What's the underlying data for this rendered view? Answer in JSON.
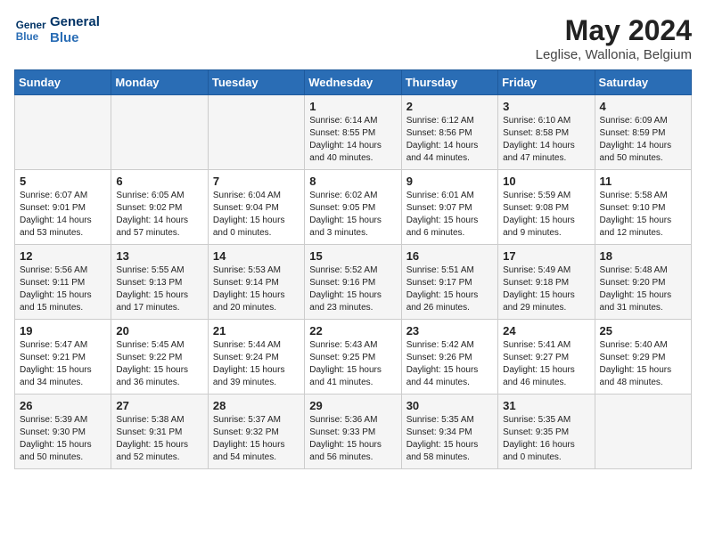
{
  "logo": {
    "line1": "General",
    "line2": "Blue"
  },
  "title": "May 2024",
  "subtitle": "Leglise, Wallonia, Belgium",
  "days_header": [
    "Sunday",
    "Monday",
    "Tuesday",
    "Wednesday",
    "Thursday",
    "Friday",
    "Saturday"
  ],
  "weeks": [
    [
      {
        "day": "",
        "info": ""
      },
      {
        "day": "",
        "info": ""
      },
      {
        "day": "",
        "info": ""
      },
      {
        "day": "1",
        "info": "Sunrise: 6:14 AM\nSunset: 8:55 PM\nDaylight: 14 hours\nand 40 minutes."
      },
      {
        "day": "2",
        "info": "Sunrise: 6:12 AM\nSunset: 8:56 PM\nDaylight: 14 hours\nand 44 minutes."
      },
      {
        "day": "3",
        "info": "Sunrise: 6:10 AM\nSunset: 8:58 PM\nDaylight: 14 hours\nand 47 minutes."
      },
      {
        "day": "4",
        "info": "Sunrise: 6:09 AM\nSunset: 8:59 PM\nDaylight: 14 hours\nand 50 minutes."
      }
    ],
    [
      {
        "day": "5",
        "info": "Sunrise: 6:07 AM\nSunset: 9:01 PM\nDaylight: 14 hours\nand 53 minutes."
      },
      {
        "day": "6",
        "info": "Sunrise: 6:05 AM\nSunset: 9:02 PM\nDaylight: 14 hours\nand 57 minutes."
      },
      {
        "day": "7",
        "info": "Sunrise: 6:04 AM\nSunset: 9:04 PM\nDaylight: 15 hours\nand 0 minutes."
      },
      {
        "day": "8",
        "info": "Sunrise: 6:02 AM\nSunset: 9:05 PM\nDaylight: 15 hours\nand 3 minutes."
      },
      {
        "day": "9",
        "info": "Sunrise: 6:01 AM\nSunset: 9:07 PM\nDaylight: 15 hours\nand 6 minutes."
      },
      {
        "day": "10",
        "info": "Sunrise: 5:59 AM\nSunset: 9:08 PM\nDaylight: 15 hours\nand 9 minutes."
      },
      {
        "day": "11",
        "info": "Sunrise: 5:58 AM\nSunset: 9:10 PM\nDaylight: 15 hours\nand 12 minutes."
      }
    ],
    [
      {
        "day": "12",
        "info": "Sunrise: 5:56 AM\nSunset: 9:11 PM\nDaylight: 15 hours\nand 15 minutes."
      },
      {
        "day": "13",
        "info": "Sunrise: 5:55 AM\nSunset: 9:13 PM\nDaylight: 15 hours\nand 17 minutes."
      },
      {
        "day": "14",
        "info": "Sunrise: 5:53 AM\nSunset: 9:14 PM\nDaylight: 15 hours\nand 20 minutes."
      },
      {
        "day": "15",
        "info": "Sunrise: 5:52 AM\nSunset: 9:16 PM\nDaylight: 15 hours\nand 23 minutes."
      },
      {
        "day": "16",
        "info": "Sunrise: 5:51 AM\nSunset: 9:17 PM\nDaylight: 15 hours\nand 26 minutes."
      },
      {
        "day": "17",
        "info": "Sunrise: 5:49 AM\nSunset: 9:18 PM\nDaylight: 15 hours\nand 29 minutes."
      },
      {
        "day": "18",
        "info": "Sunrise: 5:48 AM\nSunset: 9:20 PM\nDaylight: 15 hours\nand 31 minutes."
      }
    ],
    [
      {
        "day": "19",
        "info": "Sunrise: 5:47 AM\nSunset: 9:21 PM\nDaylight: 15 hours\nand 34 minutes."
      },
      {
        "day": "20",
        "info": "Sunrise: 5:45 AM\nSunset: 9:22 PM\nDaylight: 15 hours\nand 36 minutes."
      },
      {
        "day": "21",
        "info": "Sunrise: 5:44 AM\nSunset: 9:24 PM\nDaylight: 15 hours\nand 39 minutes."
      },
      {
        "day": "22",
        "info": "Sunrise: 5:43 AM\nSunset: 9:25 PM\nDaylight: 15 hours\nand 41 minutes."
      },
      {
        "day": "23",
        "info": "Sunrise: 5:42 AM\nSunset: 9:26 PM\nDaylight: 15 hours\nand 44 minutes."
      },
      {
        "day": "24",
        "info": "Sunrise: 5:41 AM\nSunset: 9:27 PM\nDaylight: 15 hours\nand 46 minutes."
      },
      {
        "day": "25",
        "info": "Sunrise: 5:40 AM\nSunset: 9:29 PM\nDaylight: 15 hours\nand 48 minutes."
      }
    ],
    [
      {
        "day": "26",
        "info": "Sunrise: 5:39 AM\nSunset: 9:30 PM\nDaylight: 15 hours\nand 50 minutes."
      },
      {
        "day": "27",
        "info": "Sunrise: 5:38 AM\nSunset: 9:31 PM\nDaylight: 15 hours\nand 52 minutes."
      },
      {
        "day": "28",
        "info": "Sunrise: 5:37 AM\nSunset: 9:32 PM\nDaylight: 15 hours\nand 54 minutes."
      },
      {
        "day": "29",
        "info": "Sunrise: 5:36 AM\nSunset: 9:33 PM\nDaylight: 15 hours\nand 56 minutes."
      },
      {
        "day": "30",
        "info": "Sunrise: 5:35 AM\nSunset: 9:34 PM\nDaylight: 15 hours\nand 58 minutes."
      },
      {
        "day": "31",
        "info": "Sunrise: 5:35 AM\nSunset: 9:35 PM\nDaylight: 16 hours\nand 0 minutes."
      },
      {
        "day": "",
        "info": ""
      }
    ]
  ]
}
